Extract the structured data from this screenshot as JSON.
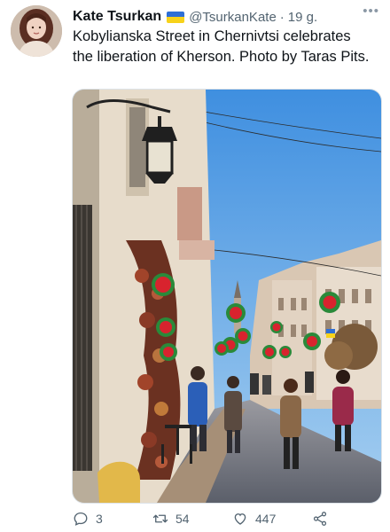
{
  "tweet": {
    "author_name": "Kate Tsurkan",
    "handle": "@TsurkanKate",
    "separator": "·",
    "time": "19 g.",
    "more_icon": "more-icon",
    "text": "Kobylianska Street in Chernivtsi celebrates the liberation of Kherson. Photo by Taras Pits.",
    "media": {
      "type": "photo",
      "icon": "photo"
    },
    "flag": {
      "blue": "#2e6fd6",
      "yellow": "#f7d21a"
    }
  },
  "actions": {
    "reply": {
      "icon": "reply-icon",
      "count": "3"
    },
    "retweet": {
      "icon": "retweet-icon",
      "count": "54"
    },
    "like": {
      "icon": "heart-icon",
      "count": "447"
    },
    "share": {
      "icon": "share-icon"
    }
  }
}
